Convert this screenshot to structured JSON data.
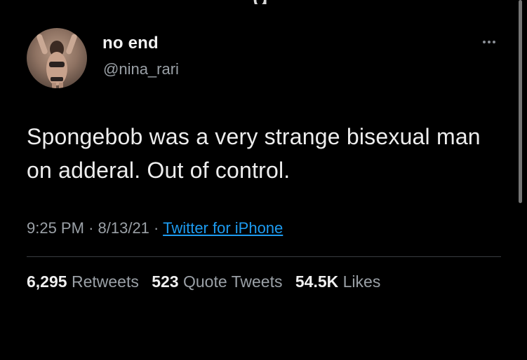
{
  "tweet": {
    "display_name": "no end",
    "handle": "@nina_rari",
    "text": "Spongebob was a very strange bisexual man on adderal. Out of control.",
    "time": "9:25 PM",
    "date": "8/13/21",
    "source": "Twitter for iPhone",
    "separator": "·"
  },
  "stats": {
    "retweets_count": "6,295",
    "retweets_label": "Retweets",
    "quotes_count": "523",
    "quotes_label": "Quote Tweets",
    "likes_count": "54.5K",
    "likes_label": "Likes"
  },
  "icons": {
    "more": "more-options-icon"
  },
  "colors": {
    "background": "#000000",
    "link": "#1d9bf0",
    "secondary_text": "#9aa0a6"
  }
}
